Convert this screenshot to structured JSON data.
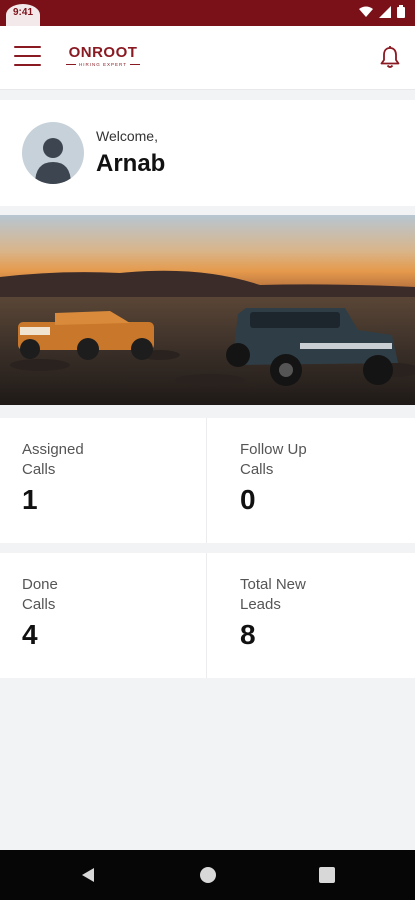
{
  "status_bar": {
    "time": "9:41",
    "icons": [
      "wifi-icon",
      "signal-icon",
      "battery-icon"
    ]
  },
  "header": {
    "brand": "ONROOT",
    "tagline": "HIRING EXPERT",
    "menu_icon": "hamburger-menu-icon",
    "notification_icon": "bell-icon"
  },
  "welcome": {
    "label": "Welcome,",
    "name": "Arnab"
  },
  "banner": {
    "image": "two off-road SUVs in a desert at sunset",
    "slide_count": 1,
    "active_slide": 1
  },
  "stats": [
    {
      "label": "Assigned\nCalls",
      "value": "1"
    },
    {
      "label": "Follow Up\nCalls",
      "value": "0"
    },
    {
      "label": "Done\nCalls",
      "value": "4"
    },
    {
      "label": "Total New\nLeads",
      "value": "8"
    }
  ],
  "nav": {
    "back_icon": "back-triangle-icon",
    "home_icon": "home-circle-icon",
    "recents_icon": "recents-square-icon"
  },
  "colors": {
    "brand": "#8a1a22",
    "status_bar": "#7a1018",
    "background": "#f2f3f5"
  }
}
